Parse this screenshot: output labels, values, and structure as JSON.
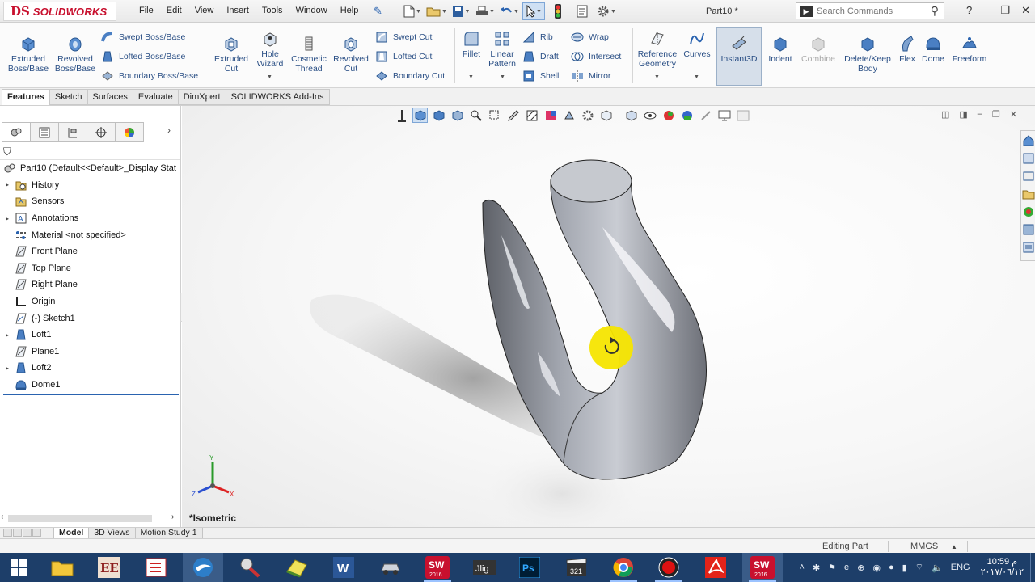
{
  "app": {
    "logo_ds": "DS",
    "logo_name": "SOLIDWORKS",
    "document_title": "Part10 *"
  },
  "menu": [
    "File",
    "Edit",
    "View",
    "Insert",
    "Tools",
    "Window",
    "Help"
  ],
  "search": {
    "placeholder": "Search Commands"
  },
  "ribbon": {
    "extruded_boss": [
      "Extruded",
      "Boss/Base"
    ],
    "revolved_boss": [
      "Revolved",
      "Boss/Base"
    ],
    "swept_boss": "Swept Boss/Base",
    "lofted_boss": "Lofted Boss/Base",
    "boundary_boss": "Boundary Boss/Base",
    "extruded_cut": [
      "Extruded",
      "Cut"
    ],
    "hole_wizard": [
      "Hole",
      "Wizard"
    ],
    "cosmetic_thread": [
      "Cosmetic",
      "Thread"
    ],
    "revolved_cut": [
      "Revolved",
      "Cut"
    ],
    "swept_cut": "Swept Cut",
    "lofted_cut": "Lofted Cut",
    "boundary_cut": "Boundary Cut",
    "fillet": "Fillet",
    "linear_pattern": [
      "Linear",
      "Pattern"
    ],
    "rib": "Rib",
    "draft": "Draft",
    "shell": "Shell",
    "wrap": "Wrap",
    "intersect": "Intersect",
    "mirror": "Mirror",
    "reference_geometry": [
      "Reference",
      "Geometry"
    ],
    "curves": "Curves",
    "instant3d": "Instant3D",
    "indent": "Indent",
    "combine": "Combine",
    "delete_keep_body": [
      "Delete/Keep",
      "Body"
    ],
    "flex": "Flex",
    "dome": "Dome",
    "freeform": "Freeform"
  },
  "cm_tabs": [
    {
      "label": "Features",
      "active": true
    },
    {
      "label": "Sketch",
      "active": false
    },
    {
      "label": "Surfaces",
      "active": false
    },
    {
      "label": "Evaluate",
      "active": false
    },
    {
      "label": "DimXpert",
      "active": false
    },
    {
      "label": "SOLIDWORKS Add-Ins",
      "active": false
    }
  ],
  "tree": {
    "root": "Part10  (Default<<Default>_Display Stat",
    "items": [
      {
        "label": "History",
        "expandable": true,
        "icon": "history-folder-icon"
      },
      {
        "label": "Sensors",
        "expandable": false,
        "icon": "sensors-icon"
      },
      {
        "label": "Annotations",
        "expandable": true,
        "icon": "annotations-icon"
      },
      {
        "label": "Material <not specified>",
        "expandable": false,
        "icon": "material-icon"
      },
      {
        "label": "Front Plane",
        "expandable": false,
        "icon": "plane-icon"
      },
      {
        "label": "Top Plane",
        "expandable": false,
        "icon": "plane-icon"
      },
      {
        "label": "Right Plane",
        "expandable": false,
        "icon": "plane-icon"
      },
      {
        "label": "Origin",
        "expandable": false,
        "icon": "origin-icon"
      },
      {
        "label": "(-) Sketch1",
        "expandable": false,
        "icon": "sketch-icon"
      },
      {
        "label": "Loft1",
        "expandable": true,
        "icon": "loft-icon"
      },
      {
        "label": "Plane1",
        "expandable": false,
        "icon": "plane-icon"
      },
      {
        "label": "Loft2",
        "expandable": true,
        "icon": "loft-icon"
      },
      {
        "label": "Dome1",
        "expandable": false,
        "icon": "dome-icon"
      }
    ]
  },
  "viewport": {
    "view_name": "*Isometric",
    "triad_labels": [
      "Y",
      "Z",
      "X"
    ]
  },
  "bottom_tabs": [
    {
      "label": "Model",
      "active": true
    },
    {
      "label": "3D Views",
      "active": false
    },
    {
      "label": "Motion Study 1",
      "active": false
    }
  ],
  "status": {
    "mode": "Editing Part",
    "units": "MMGS"
  },
  "taskbar": {
    "apps": [
      "windows-start-icon",
      "file-explorer-icon",
      "ees-icon",
      "task-list-icon",
      "bird-app-icon",
      "tools-app-icon",
      "yellow-app-icon",
      "word-icon",
      "car-app-icon",
      "solidworks-2016-icon",
      "tag-app-icon",
      "photoshop-icon",
      "clapper-app-icon",
      "chrome-icon",
      "record-app-icon",
      "acrobat-icon",
      "solidworks-2016-active-icon"
    ],
    "language": "ENG",
    "time": "10:59 م",
    "date": "٢٠١٧/٠٦/١٢"
  },
  "colors": {
    "brand_red": "#c8102e",
    "ribbon_text": "#2a4f85",
    "taskbar": "#1d3e69",
    "cursor_highlight": "#f5e500"
  }
}
